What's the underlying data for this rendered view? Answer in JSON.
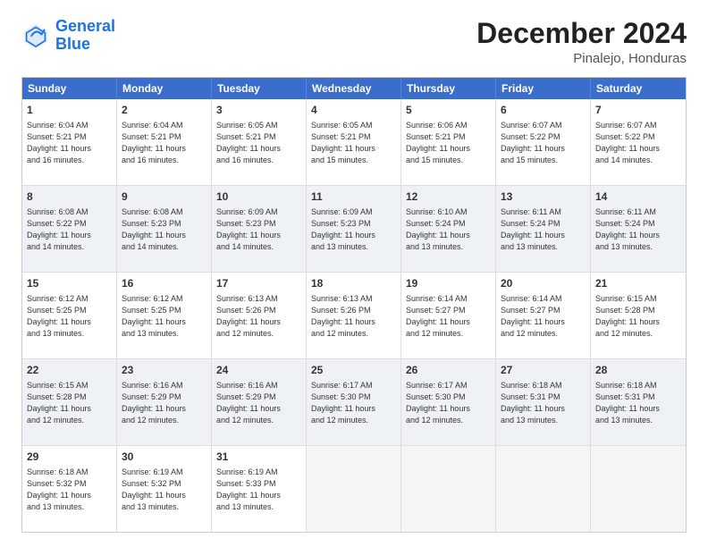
{
  "logo": {
    "line1": "General",
    "line2": "Blue"
  },
  "title": "December 2024",
  "location": "Pinalejo, Honduras",
  "header_days": [
    "Sunday",
    "Monday",
    "Tuesday",
    "Wednesday",
    "Thursday",
    "Friday",
    "Saturday"
  ],
  "rows": [
    {
      "alt": false,
      "cells": [
        {
          "day": "1",
          "lines": [
            "Sunrise: 6:04 AM",
            "Sunset: 5:21 PM",
            "Daylight: 11 hours",
            "and 16 minutes."
          ]
        },
        {
          "day": "2",
          "lines": [
            "Sunrise: 6:04 AM",
            "Sunset: 5:21 PM",
            "Daylight: 11 hours",
            "and 16 minutes."
          ]
        },
        {
          "day": "3",
          "lines": [
            "Sunrise: 6:05 AM",
            "Sunset: 5:21 PM",
            "Daylight: 11 hours",
            "and 16 minutes."
          ]
        },
        {
          "day": "4",
          "lines": [
            "Sunrise: 6:05 AM",
            "Sunset: 5:21 PM",
            "Daylight: 11 hours",
            "and 15 minutes."
          ]
        },
        {
          "day": "5",
          "lines": [
            "Sunrise: 6:06 AM",
            "Sunset: 5:21 PM",
            "Daylight: 11 hours",
            "and 15 minutes."
          ]
        },
        {
          "day": "6",
          "lines": [
            "Sunrise: 6:07 AM",
            "Sunset: 5:22 PM",
            "Daylight: 11 hours",
            "and 15 minutes."
          ]
        },
        {
          "day": "7",
          "lines": [
            "Sunrise: 6:07 AM",
            "Sunset: 5:22 PM",
            "Daylight: 11 hours",
            "and 14 minutes."
          ]
        }
      ]
    },
    {
      "alt": true,
      "cells": [
        {
          "day": "8",
          "lines": [
            "Sunrise: 6:08 AM",
            "Sunset: 5:22 PM",
            "Daylight: 11 hours",
            "and 14 minutes."
          ]
        },
        {
          "day": "9",
          "lines": [
            "Sunrise: 6:08 AM",
            "Sunset: 5:23 PM",
            "Daylight: 11 hours",
            "and 14 minutes."
          ]
        },
        {
          "day": "10",
          "lines": [
            "Sunrise: 6:09 AM",
            "Sunset: 5:23 PM",
            "Daylight: 11 hours",
            "and 14 minutes."
          ]
        },
        {
          "day": "11",
          "lines": [
            "Sunrise: 6:09 AM",
            "Sunset: 5:23 PM",
            "Daylight: 11 hours",
            "and 13 minutes."
          ]
        },
        {
          "day": "12",
          "lines": [
            "Sunrise: 6:10 AM",
            "Sunset: 5:24 PM",
            "Daylight: 11 hours",
            "and 13 minutes."
          ]
        },
        {
          "day": "13",
          "lines": [
            "Sunrise: 6:11 AM",
            "Sunset: 5:24 PM",
            "Daylight: 11 hours",
            "and 13 minutes."
          ]
        },
        {
          "day": "14",
          "lines": [
            "Sunrise: 6:11 AM",
            "Sunset: 5:24 PM",
            "Daylight: 11 hours",
            "and 13 minutes."
          ]
        }
      ]
    },
    {
      "alt": false,
      "cells": [
        {
          "day": "15",
          "lines": [
            "Sunrise: 6:12 AM",
            "Sunset: 5:25 PM",
            "Daylight: 11 hours",
            "and 13 minutes."
          ]
        },
        {
          "day": "16",
          "lines": [
            "Sunrise: 6:12 AM",
            "Sunset: 5:25 PM",
            "Daylight: 11 hours",
            "and 13 minutes."
          ]
        },
        {
          "day": "17",
          "lines": [
            "Sunrise: 6:13 AM",
            "Sunset: 5:26 PM",
            "Daylight: 11 hours",
            "and 12 minutes."
          ]
        },
        {
          "day": "18",
          "lines": [
            "Sunrise: 6:13 AM",
            "Sunset: 5:26 PM",
            "Daylight: 11 hours",
            "and 12 minutes."
          ]
        },
        {
          "day": "19",
          "lines": [
            "Sunrise: 6:14 AM",
            "Sunset: 5:27 PM",
            "Daylight: 11 hours",
            "and 12 minutes."
          ]
        },
        {
          "day": "20",
          "lines": [
            "Sunrise: 6:14 AM",
            "Sunset: 5:27 PM",
            "Daylight: 11 hours",
            "and 12 minutes."
          ]
        },
        {
          "day": "21",
          "lines": [
            "Sunrise: 6:15 AM",
            "Sunset: 5:28 PM",
            "Daylight: 11 hours",
            "and 12 minutes."
          ]
        }
      ]
    },
    {
      "alt": true,
      "cells": [
        {
          "day": "22",
          "lines": [
            "Sunrise: 6:15 AM",
            "Sunset: 5:28 PM",
            "Daylight: 11 hours",
            "and 12 minutes."
          ]
        },
        {
          "day": "23",
          "lines": [
            "Sunrise: 6:16 AM",
            "Sunset: 5:29 PM",
            "Daylight: 11 hours",
            "and 12 minutes."
          ]
        },
        {
          "day": "24",
          "lines": [
            "Sunrise: 6:16 AM",
            "Sunset: 5:29 PM",
            "Daylight: 11 hours",
            "and 12 minutes."
          ]
        },
        {
          "day": "25",
          "lines": [
            "Sunrise: 6:17 AM",
            "Sunset: 5:30 PM",
            "Daylight: 11 hours",
            "and 12 minutes."
          ]
        },
        {
          "day": "26",
          "lines": [
            "Sunrise: 6:17 AM",
            "Sunset: 5:30 PM",
            "Daylight: 11 hours",
            "and 12 minutes."
          ]
        },
        {
          "day": "27",
          "lines": [
            "Sunrise: 6:18 AM",
            "Sunset: 5:31 PM",
            "Daylight: 11 hours",
            "and 13 minutes."
          ]
        },
        {
          "day": "28",
          "lines": [
            "Sunrise: 6:18 AM",
            "Sunset: 5:31 PM",
            "Daylight: 11 hours",
            "and 13 minutes."
          ]
        }
      ]
    },
    {
      "alt": false,
      "cells": [
        {
          "day": "29",
          "lines": [
            "Sunrise: 6:18 AM",
            "Sunset: 5:32 PM",
            "Daylight: 11 hours",
            "and 13 minutes."
          ]
        },
        {
          "day": "30",
          "lines": [
            "Sunrise: 6:19 AM",
            "Sunset: 5:32 PM",
            "Daylight: 11 hours",
            "and 13 minutes."
          ]
        },
        {
          "day": "31",
          "lines": [
            "Sunrise: 6:19 AM",
            "Sunset: 5:33 PM",
            "Daylight: 11 hours",
            "and 13 minutes."
          ]
        },
        {
          "day": "",
          "lines": []
        },
        {
          "day": "",
          "lines": []
        },
        {
          "day": "",
          "lines": []
        },
        {
          "day": "",
          "lines": []
        }
      ]
    }
  ]
}
